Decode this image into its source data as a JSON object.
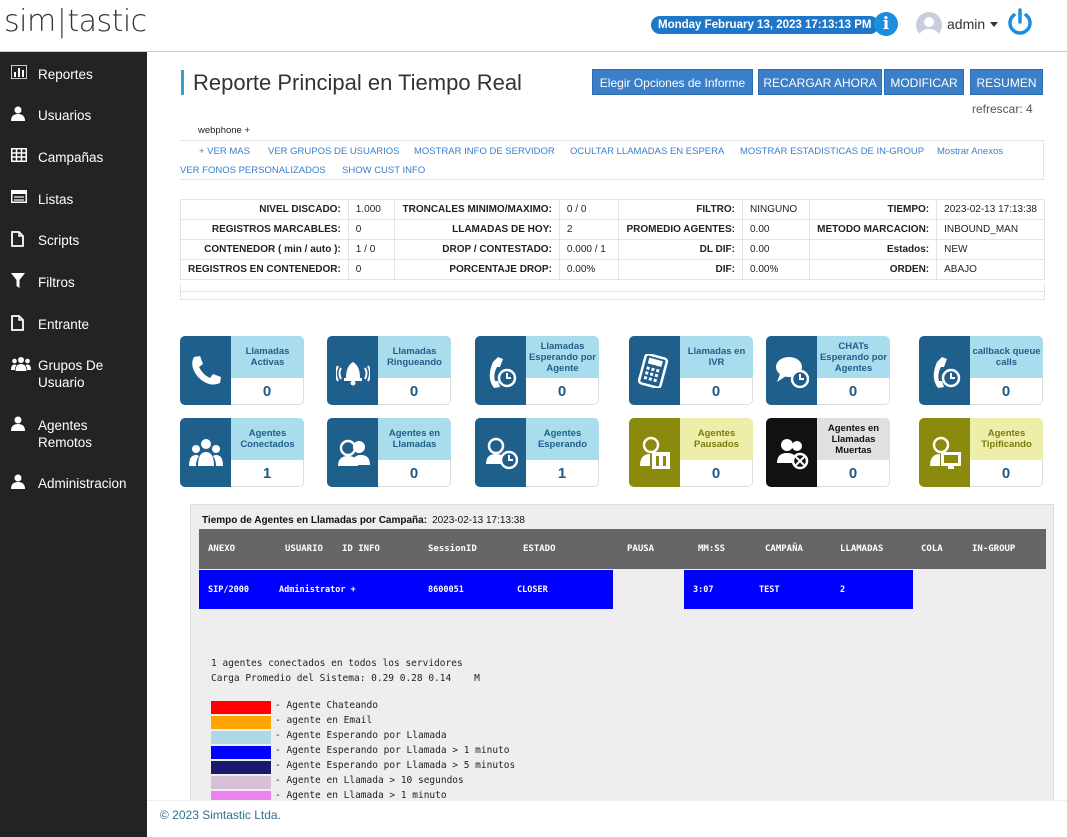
{
  "app": {
    "logo_left": "sim",
    "logo_right": "tastic"
  },
  "header": {
    "datetime": "Monday February 13, 2023 17:13:13 PM",
    "user": "admin"
  },
  "sidebar": {
    "items": [
      {
        "label": "Reportes",
        "icon": "bar-chart-icon"
      },
      {
        "label": "Usuarios",
        "icon": "user-icon"
      },
      {
        "label": "Campañas",
        "icon": "grid-icon"
      },
      {
        "label": "Listas",
        "icon": "list-icon"
      },
      {
        "label": "Scripts",
        "icon": "file-icon"
      },
      {
        "label": "Filtros",
        "icon": "filter-icon"
      },
      {
        "label": "Entrante",
        "icon": "file-icon"
      },
      {
        "label": "Grupos De Usuario",
        "icon": "users-icon"
      },
      {
        "label": "Agentes Remotos",
        "icon": "user-icon"
      },
      {
        "label": "Administracion",
        "icon": "user-icon"
      }
    ]
  },
  "page": {
    "title": "Reporte Principal en Tiempo Real",
    "buttons": [
      "Elegir Opciones de Informe",
      "RECARGAR AHORA",
      "MODIFICAR",
      "RESUMEN"
    ],
    "refresh": "refrescar: 4",
    "webphone": "webphone +",
    "links": [
      "+ VER MAS",
      "VER GRUPOS DE USUARIOS",
      "MOSTRAR INFO DE SERVIDOR",
      "OCULTAR LLAMADAS EN ESPERA",
      "MOSTRAR ESTADISTICAS DE IN-GROUP",
      "Mostrar Anexos",
      "VER FONOS PERSONALIZADOS",
      "SHOW CUST INFO"
    ]
  },
  "stats": [
    [
      [
        "NIVEL DISCADO:",
        "1.000"
      ],
      [
        "TRONCALES MINIMO/MAXIMO:",
        "0 / 0"
      ],
      [
        "FILTRO:",
        "NINGUNO"
      ],
      [
        "TIEMPO:",
        "2023-02-13 17:13:38"
      ]
    ],
    [
      [
        "REGISTROS MARCABLES:",
        "0"
      ],
      [
        "LLAMADAS DE HOY:",
        "2"
      ],
      [
        "PROMEDIO AGENTES:",
        "0.00"
      ],
      [
        "METODO MARCACION:",
        "INBOUND_MAN"
      ]
    ],
    [
      [
        "CONTENEDOR ( min / auto ):",
        "1 / 0"
      ],
      [
        "DROP / CONTESTADO:",
        "0.000 / 1"
      ],
      [
        "DL DIF:",
        "0.00"
      ],
      [
        "Estados:",
        "NEW"
      ]
    ],
    [
      [
        "REGISTROS EN CONTENEDOR:",
        "0"
      ],
      [
        "PORCENTAJE DROP:",
        "0.00%"
      ],
      [
        "DIF:",
        "0.00%"
      ],
      [
        "ORDEN:",
        "ABAJO"
      ]
    ]
  ],
  "tiles": [
    {
      "label": "Llamadas Activas",
      "value": "0",
      "style": "blu",
      "icon": "phone-icon"
    },
    {
      "label": "Llamadas Ringueando",
      "value": "0",
      "style": "blu",
      "icon": "bell-icon"
    },
    {
      "label": "Llamadas Esperando por Agente",
      "value": "0",
      "style": "blu",
      "icon": "phone-clock-icon"
    },
    {
      "label": "Llamadas en IVR",
      "value": "0",
      "style": "blu",
      "icon": "keypad-icon"
    },
    {
      "label": "CHATs Esperando por Agentes",
      "value": "0",
      "style": "blu",
      "icon": "chat-clock-icon"
    },
    {
      "label": "callback queue calls",
      "value": "0",
      "style": "blu",
      "icon": "phone-clock-icon"
    },
    {
      "label": "Agentes Conectados",
      "value": "1",
      "style": "blu",
      "icon": "group-icon"
    },
    {
      "label": "Agentes en Llamadas",
      "value": "0",
      "style": "blu",
      "icon": "headset-icon"
    },
    {
      "label": "Agentes Esperando",
      "value": "1",
      "style": "blu",
      "icon": "headset-clock-icon"
    },
    {
      "label": "Agentes Pausados",
      "value": "0",
      "style": "oli",
      "icon": "headset-pause-icon"
    },
    {
      "label": "Agentes en Llamadas Muertas",
      "value": "0",
      "style": "blk",
      "icon": "headset-dead-icon"
    },
    {
      "label": "Agentes Tipificando",
      "value": "0",
      "style": "oli",
      "icon": "headset-screen-icon"
    }
  ],
  "agents_panel": {
    "title": "Tiempo de Agentes en Llamadas por Campaña:",
    "date": "2023-02-13 17:13:38",
    "columns": [
      "ANEXO",
      "USUARIO",
      "ID INFO",
      "SessionID",
      "ESTADO",
      "PAUSA",
      "MM:SS",
      "CAMPAÑA",
      "LLAMADAS",
      "COLA",
      "IN-GROUP"
    ],
    "row": {
      "anexo": "SIP/2000",
      "usuario": "Administrator +",
      "session": "8600051",
      "estado": "CLOSER",
      "pausa": "",
      "mmss": "3:07",
      "campana": "TEST",
      "llamadas": "2",
      "row_color": "#0000ff"
    },
    "summary_1": "1 agentes conectados en todos los servidores",
    "summary_2": "Carga Promedio del Sistema: 0.29 0.28 0.14    M",
    "legend": [
      {
        "color": "#ff0000",
        "label": "- Agente Chateando"
      },
      {
        "color": "#ffa500",
        "label": "- agente en Email"
      },
      {
        "color": "#add8e6",
        "label": "- Agente Esperando por Llamada"
      },
      {
        "color": "#0000ff",
        "label": "- Agente Esperando por Llamada > 1 minuto"
      },
      {
        "color": "#191970",
        "label": "- Agente Esperando por Llamada > 5 minutos"
      },
      {
        "color": "#d8bfd8",
        "label": "- Agente en Llamada > 10 segundos"
      },
      {
        "color": "#ee82ee",
        "label": "- Agente en Llamada > 1 minuto"
      }
    ]
  },
  "footer": {
    "copyright": "© 2023 Simtastic Ltda."
  }
}
